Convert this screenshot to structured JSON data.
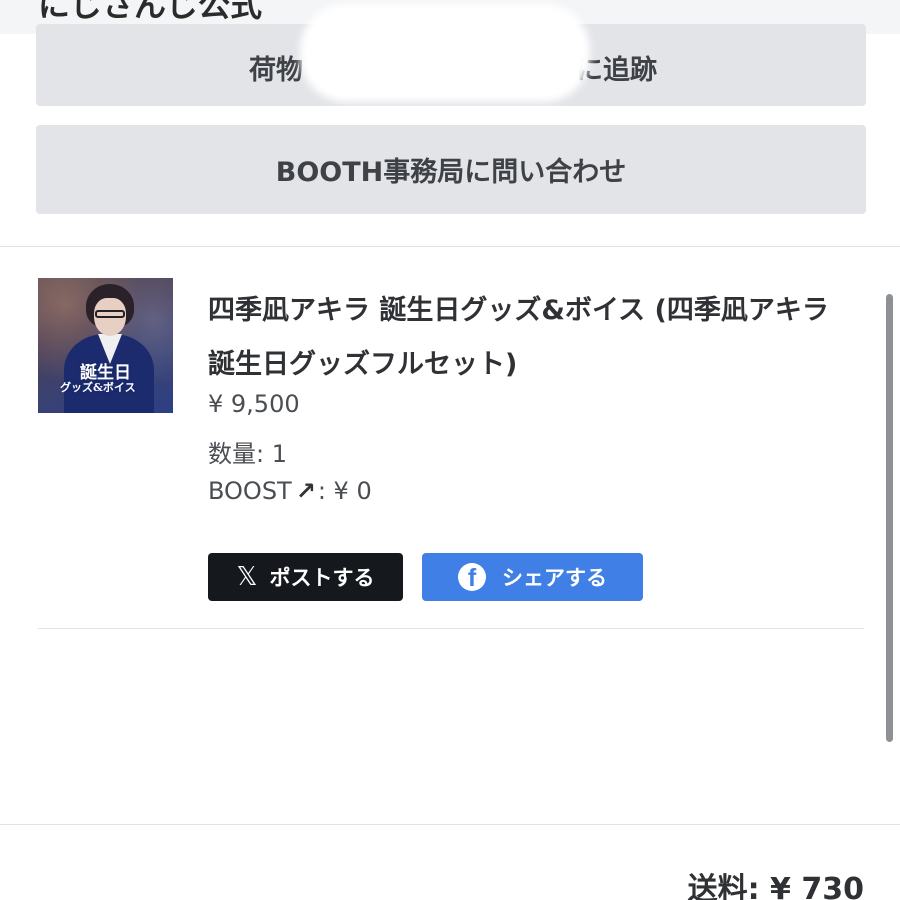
{
  "header": {
    "shop_name": "にじさんじ公式"
  },
  "actions": {
    "track_label_start": "荷物",
    "track_label_end": "に追跡",
    "contact_label": "BOOTH事務局に問い合わせ"
  },
  "item": {
    "thumbnail_text_line1": "誕生日",
    "thumbnail_text_line2": "グッズ&ボイス",
    "title": "四季凪アキラ 誕生日グッズ&ボイス (四季凪アキラ 誕生日グッズフルセット)",
    "price": "¥ 9,500",
    "quantity": "数量: 1",
    "boost_label": "BOOST",
    "boost_icon": "↗",
    "boost_value": ": ¥ 0"
  },
  "share": {
    "x_icon": "𝕏",
    "x_label": "ポストする",
    "facebook_icon": "f",
    "facebook_label": "シェアする"
  },
  "footer": {
    "shipping": "送料: ¥ 730"
  },
  "colors": {
    "button_gray": "#e2e4e8",
    "x_black": "#15181d",
    "facebook_blue": "#3f7fe6"
  }
}
